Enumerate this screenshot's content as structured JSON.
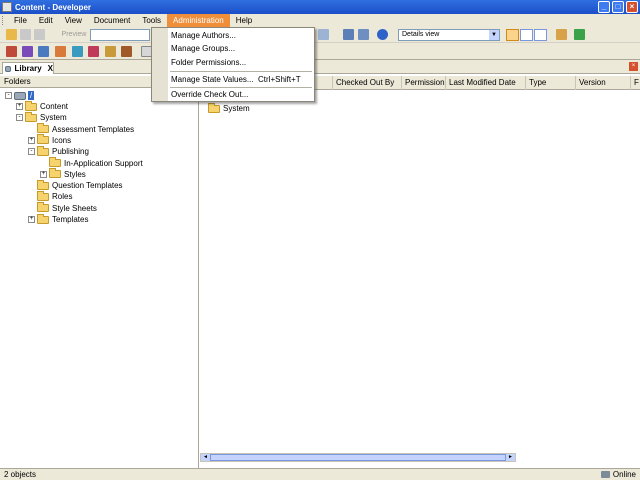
{
  "window": {
    "title": "Content - Developer"
  },
  "menubar": {
    "items": [
      "File",
      "Edit",
      "View",
      "Document",
      "Tools",
      "Administration",
      "Help"
    ],
    "active": "Administration"
  },
  "administration_menu": {
    "items": [
      {
        "label": "Manage Authors...",
        "shortcut": ""
      },
      {
        "label": "Manage Groups...",
        "shortcut": ""
      },
      {
        "label": "Folder Permissions...",
        "shortcut": ""
      },
      {
        "label": "Manage State Values...",
        "shortcut": "Ctrl+Shift+T"
      },
      {
        "label": "Override Check Out...",
        "shortcut": ""
      }
    ]
  },
  "toolbar": {
    "preview_label": "Preview",
    "view_select": "Details view"
  },
  "library_tab": {
    "label": "Library",
    "close": "X"
  },
  "folders_pane": {
    "header": "Folders",
    "root": "/",
    "tree": [
      {
        "label": "Content",
        "level": 1,
        "expander": "+"
      },
      {
        "label": "System",
        "level": 1,
        "expander": "-"
      },
      {
        "label": "Assessment Templates",
        "level": 2,
        "expander": ""
      },
      {
        "label": "Icons",
        "level": 2,
        "expander": "+"
      },
      {
        "label": "Publishing",
        "level": 2,
        "expander": "-"
      },
      {
        "label": "In-Application Support",
        "level": 3,
        "expander": ""
      },
      {
        "label": "Styles",
        "level": 3,
        "expander": "+"
      },
      {
        "label": "Question Templates",
        "level": 2,
        "expander": ""
      },
      {
        "label": "Roles",
        "level": 2,
        "expander": ""
      },
      {
        "label": "Style Sheets",
        "level": 2,
        "expander": ""
      },
      {
        "label": "Templates",
        "level": 2,
        "expander": "+"
      }
    ]
  },
  "details_pane": {
    "columns": [
      "Checked Out By",
      "Permission",
      "Last Modified Date",
      "Type",
      "Version",
      "F"
    ],
    "rows": [
      {
        "name": "System"
      }
    ]
  },
  "statusbar": {
    "left": "2 objects",
    "right": "Online"
  },
  "colors": {
    "titlebar": "#1c4fc8",
    "menu_highlight": "#ef8f3a",
    "selection": "#316ac5"
  }
}
